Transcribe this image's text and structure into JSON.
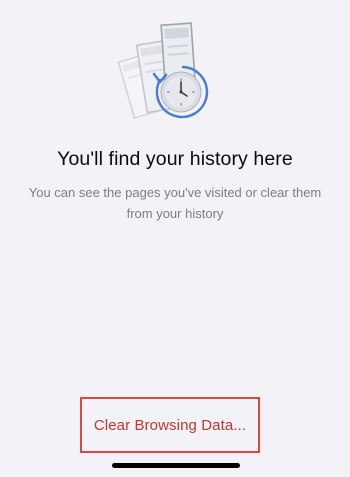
{
  "empty_state": {
    "illustration_icon": "history-clock-pages-icon",
    "title": "You'll find your history here",
    "description": "You can see the pages you've visited or clear them from your history"
  },
  "actions": {
    "clear_browsing_data_label": "Clear Browsing Data..."
  },
  "colors": {
    "background": "#f2f2f7",
    "accent_blue": "#4a7bd6",
    "destructive_red": "#c9342c",
    "highlight_border": "#e0473f"
  }
}
